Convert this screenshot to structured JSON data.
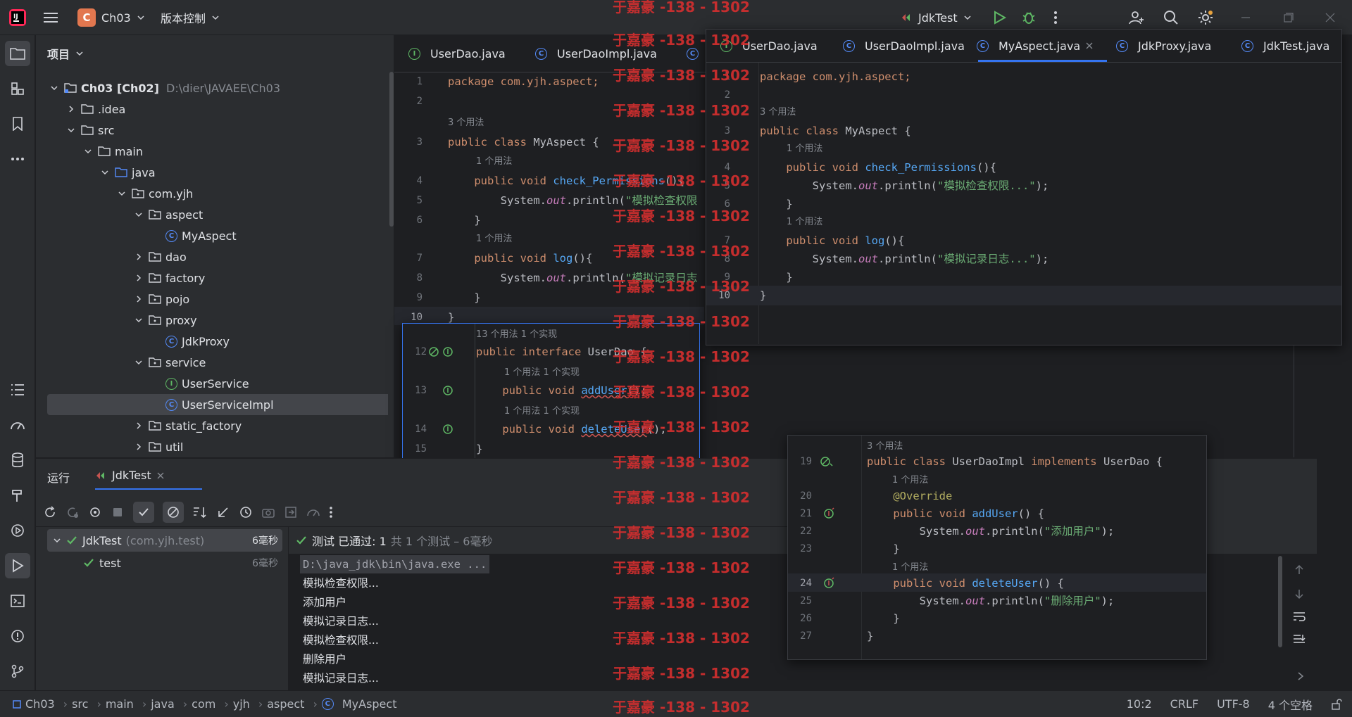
{
  "titlebar": {
    "project_badge": "C",
    "project_name": "Ch03",
    "vcs": "版本控制",
    "run_config": "JdkTest"
  },
  "project_panel": {
    "title": "项目",
    "root_name": "Ch03 [Ch02]",
    "root_path": "D:\\dier\\JAVAEE\\Ch03",
    "items": [
      {
        "label": ".idea"
      },
      {
        "label": "src"
      },
      {
        "label": "main"
      },
      {
        "label": "java"
      },
      {
        "label": "com.yjh"
      },
      {
        "label": "aspect"
      },
      {
        "label": "MyAspect"
      },
      {
        "label": "dao"
      },
      {
        "label": "factory"
      },
      {
        "label": "pojo"
      },
      {
        "label": "proxy"
      },
      {
        "label": "JdkProxy"
      },
      {
        "label": "service"
      },
      {
        "label": "UserService"
      },
      {
        "label": "UserServiceImpl"
      },
      {
        "label": "static_factory"
      },
      {
        "label": "util"
      }
    ]
  },
  "editor": {
    "tabs": [
      "UserDao.java",
      "UserDaoImpl.java"
    ],
    "code": {
      "l1": "package com.yjh.aspect;",
      "h3": "3 个用法",
      "l3a": "public class ",
      "l3b": "MyAspect {",
      "h4": "1 个用法",
      "l4a": "    public void ",
      "l4b": "check_Permissions",
      "l4c": "(){",
      "l5a": "        System.",
      "l5b": "out",
      "l5c": ".println(",
      "l5d": "\"模拟检查权限",
      "l6": "    }",
      "h7": "1 个用法",
      "l7a": "    public void ",
      "l7b": "log",
      "l7c": "(){",
      "l8a": "        System.",
      "l8b": "out",
      "l8c": ".println(",
      "l8d": "\"模拟记录日志",
      "l9": "    }",
      "l10": "}"
    },
    "line_numbers": [
      "1",
      "2",
      "3",
      "4",
      "5",
      "6",
      "7",
      "8",
      "9",
      "10"
    ]
  },
  "popup_userdao": {
    "hint1": "13 个用法   1 个实现",
    "l12a": "public interface ",
    "l12b": "UserDao {",
    "hint2": "1 个用法   1 个实现",
    "l13a": "    public void ",
    "l13b": "addUser",
    "l13c": "();",
    "hint3": "1 个用法   1 个实现",
    "l14a": "    public void ",
    "l14b": "deleteUser",
    "l14c": "();",
    "l15": "}",
    "line_numbers": [
      "12",
      "13",
      "14",
      "15"
    ]
  },
  "popup_myaspect": {
    "tabs": [
      "UserDao.java",
      "UserDaoImpl.java",
      "MyAspect.java",
      "JdkProxy.java",
      "JdkTest.java"
    ],
    "active_tab": "MyAspect.java",
    "l1": "package com.yjh.aspect;",
    "h3": "3 个用法",
    "l3a": "public class ",
    "l3b": "MyAspect {",
    "h4": "1 个用法",
    "l4a": "    public void ",
    "l4b": "check_Permissions",
    "l4c": "(){",
    "l5a": "        System.",
    "l5b": "out",
    "l5c": ".println(",
    "l5d": "\"模拟检查权限...\"",
    "l5e": ");",
    "l6": "    }",
    "h7": "1 个用法",
    "l7a": "    public void ",
    "l7b": "log",
    "l7c": "(){",
    "l8a": "        System.",
    "l8b": "out",
    "l8c": ".println(",
    "l8d": "\"模拟记录日志...\"",
    "l8e": ");",
    "l9": "    }",
    "l10": "}",
    "line_numbers": [
      "1",
      "2",
      "3",
      "4",
      "5",
      "6",
      "7",
      "8",
      "9",
      "10"
    ]
  },
  "popup_impl": {
    "h19": "3 个用法",
    "l19a": "public class ",
    "l19b": "UserDaoImpl ",
    "l19c": "implements ",
    "l19d": "UserDao {",
    "h20": "1 个用法",
    "l20": "    @Override",
    "l21a": "    public void ",
    "l21b": "addUser",
    "l21c": "() {",
    "l22a": "        System.",
    "l22b": "out",
    "l22c": ".println(",
    "l22d": "\"添加用户\"",
    "l22e": ");",
    "l23": "    }",
    "h24": "1 个用法",
    "l24a": "    public void ",
    "l24b": "deleteUser",
    "l24c": "() {",
    "l25a": "        System.",
    "l25b": "out",
    "l25c": ".println(",
    "l25d": "\"删除用户\"",
    "l25e": ");",
    "l26": "    }",
    "l27": "}",
    "line_numbers": [
      "19",
      "20",
      "21",
      "22",
      "23",
      "24",
      "25",
      "26",
      "27"
    ]
  },
  "run_panel": {
    "title": "运行",
    "tab": "JdkTest",
    "tree_root": "JdkTest",
    "tree_root_pkg": "(com.yjh.test)",
    "tree_root_time": "6毫秒",
    "tree_child": "test",
    "tree_child_time": "6毫秒",
    "status_main": "测试 已通过: 1",
    "status_sub": "共 1 个测试 – 6毫秒",
    "output": [
      "D:\\java_jdk\\bin\\java.exe ...",
      "模拟检查权限...",
      "添加用户",
      "模拟记录日志...",
      "模拟检查权限...",
      "删除用户",
      "模拟记录日志..."
    ]
  },
  "statusbar": {
    "crumbs": [
      "Ch03",
      "src",
      "main",
      "java",
      "com",
      "yjh",
      "aspect",
      "MyAspect"
    ],
    "position": "10:2",
    "line_sep": "CRLF",
    "encoding": "UTF-8",
    "indent": "4 个空格"
  },
  "watermark": "于嘉豪 -138 - 1302",
  "colors": {
    "accent": "#548af7",
    "success": "#5fb865",
    "brand_badge": "#e2774f",
    "watermark": "#d32f2f"
  }
}
